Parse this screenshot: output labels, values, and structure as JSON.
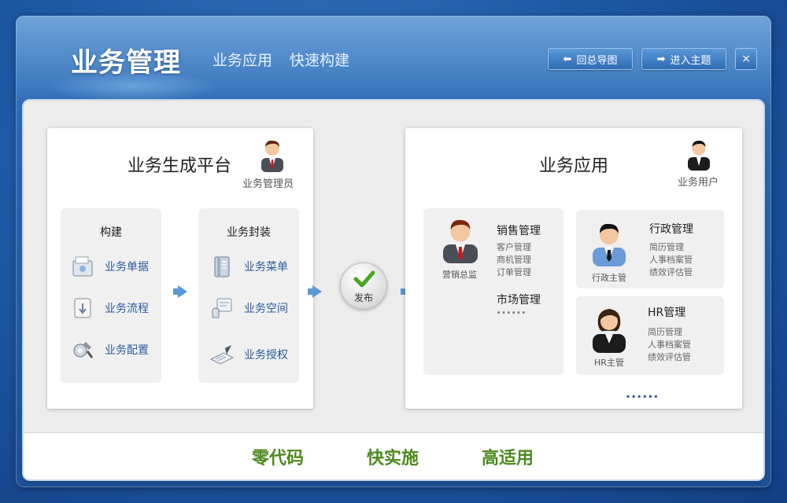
{
  "header": {
    "title": "业务管理",
    "subtitle1": "业务应用",
    "subtitle2": "快速构建",
    "btn_back": "回总导图",
    "btn_enter": "进入主题",
    "btn_close": "×"
  },
  "left_panel": {
    "title": "业务生成平台",
    "role": "业务管理员",
    "build_card": {
      "title": "构建",
      "items": [
        "业务单据",
        "业务流程",
        "业务配置"
      ]
    },
    "package_card": {
      "title": "业务封装",
      "items": [
        "业务菜单",
        "业务空间",
        "业务授权"
      ]
    }
  },
  "publish": {
    "label": "发布"
  },
  "right_panel": {
    "title": "业务应用",
    "role": "业务用户",
    "sales": {
      "person": "营销总监",
      "title": "销售管理",
      "sub": [
        "客户管理",
        "商机管理",
        "订单管理"
      ],
      "title2": "市场管理",
      "dots": "......"
    },
    "admin": {
      "person": "行政主管",
      "title": "行政管理",
      "sub": [
        "简历管理",
        "人事档案管",
        "绩效评估管"
      ]
    },
    "hr": {
      "person": "HR主管",
      "title": "HR管理",
      "sub": [
        "简历管理",
        "人事档案管",
        "绩效评估管"
      ]
    },
    "more": "......"
  },
  "footer": {
    "slogans": [
      "零代码",
      "快实施",
      "高适用"
    ]
  },
  "colors": {
    "accent": "#2b5b9f",
    "slogan": "#4c8a1d",
    "frame": "#1f5aa6"
  }
}
